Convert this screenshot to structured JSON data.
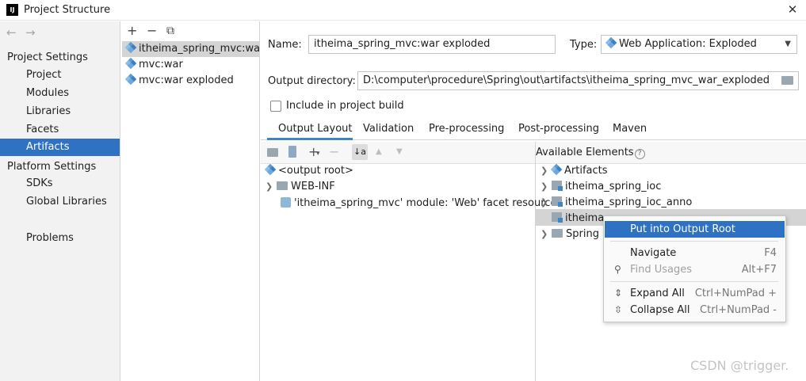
{
  "window": {
    "logo_text": "IJ",
    "title": "Project Structure",
    "close_glyph": "✕"
  },
  "nav": {
    "back_glyph": "←",
    "forward_glyph": "→"
  },
  "sidebar": {
    "project_settings_header": "Project Settings",
    "project_items": [
      "Project",
      "Modules",
      "Libraries",
      "Facets",
      "Artifacts"
    ],
    "selected_item": "Artifacts",
    "platform_settings_header": "Platform Settings",
    "platform_items": [
      "SDKs",
      "Global Libraries"
    ],
    "problems": "Problems"
  },
  "artifacts": {
    "toolbar": {
      "add": "+",
      "remove": "−",
      "copy": "⧉"
    },
    "items": [
      "itheima_spring_mvc:war exploded",
      "mvc:war",
      "mvc:war exploded"
    ],
    "selected_index": 0
  },
  "editor": {
    "name_label": "Name:",
    "name_value": "itheima_spring_mvc:war exploded",
    "type_label": "Type:",
    "type_value": "Web Application: Exploded",
    "type_arrow": "▼",
    "output_dir_label": "Output directory:",
    "output_dir_value": "D:\\computer\\procedure\\Spring\\out\\artifacts\\itheima_spring_mvc_war_exploded",
    "include_build_label": "Include in project build",
    "include_build_checked": false
  },
  "tabs": [
    "Output Layout",
    "Validation",
    "Pre-processing",
    "Post-processing",
    "Maven"
  ],
  "active_tab": "Output Layout",
  "layout_toolbar": {
    "add": "+",
    "add_caret": "▾",
    "remove": "−",
    "sort": "↓a",
    "up": "▲",
    "down": "▼"
  },
  "output_tree": {
    "root": "<output root>",
    "web_inf": "WEB-INF",
    "facet_resources": "'itheima_spring_mvc' module: 'Web' facet resources"
  },
  "available": {
    "header": "Available Elements",
    "help_glyph": "?",
    "items": [
      "Artifacts",
      "itheima_spring_ioc",
      "itheima_spring_ioc_anno",
      "itheima",
      "Spring"
    ]
  },
  "context_menu": {
    "put_into_output_root": "Put into Output Root",
    "navigate": "Navigate",
    "navigate_shortcut": "F4",
    "find_usages": "Find Usages",
    "find_usages_shortcut": "Alt+F7",
    "expand_all": "Expand All",
    "expand_all_shortcut": "Ctrl+NumPad +",
    "collapse_all": "Collapse All",
    "collapse_all_shortcut": "Ctrl+NumPad -"
  },
  "watermark": "CSDN @trigger.",
  "colors": {
    "selection_blue": "#2f72c4",
    "tab_underline": "#4083c9",
    "folder_gray": "#9aa7b0"
  }
}
